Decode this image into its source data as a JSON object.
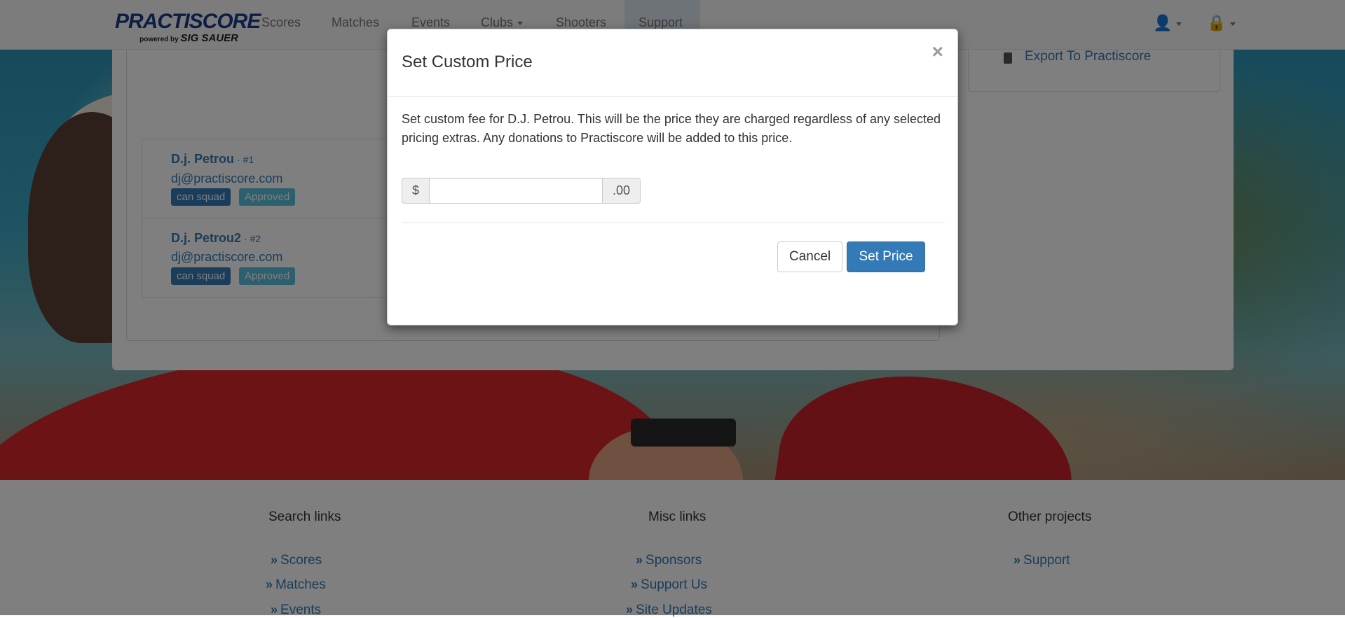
{
  "navbar": {
    "logo_text": "PRACTISCORE",
    "logo_sub": "powered by",
    "logo_brand": "SIG SAUER",
    "items": [
      {
        "label": "Scores"
      },
      {
        "label": "Matches"
      },
      {
        "label": "Events"
      },
      {
        "label": "Clubs"
      },
      {
        "label": "Shooters"
      },
      {
        "label": "Support"
      }
    ]
  },
  "side": {
    "export_link": "Export To Practiscore"
  },
  "shooters": [
    {
      "name": "D.j. Petrou",
      "num": "· #1",
      "email": "dj@practiscore.com",
      "badge1": "can squad",
      "badge2": "Approved"
    },
    {
      "name": "D.j. Petrou2",
      "num": "· #2",
      "email": "dj@practiscore.com",
      "badge1": "can squad",
      "badge2": "Approved"
    }
  ],
  "footer": {
    "col1": {
      "heading": "Search links",
      "links": [
        "Scores",
        "Matches",
        "Events"
      ]
    },
    "col2": {
      "heading": "Misc links",
      "links": [
        "Sponsors",
        "Support Us",
        "Site Updates"
      ]
    },
    "col3": {
      "heading": "Other projects",
      "links": [
        "Support"
      ]
    }
  },
  "modal": {
    "title": "Set Custom Price",
    "close": "×",
    "body": "Set custom fee for D.J. Petrou. This will be the price they are charged regardless of any selected pricing extras. Any donations to Practiscore will be added to this price.",
    "prefix": "$",
    "suffix": ".00",
    "price_value": "",
    "cancel_label": "Cancel",
    "submit_label": "Set Price"
  },
  "colors": {
    "primary": "#337ab7",
    "info": "#5bc0de",
    "brand": "#1c3b87"
  }
}
